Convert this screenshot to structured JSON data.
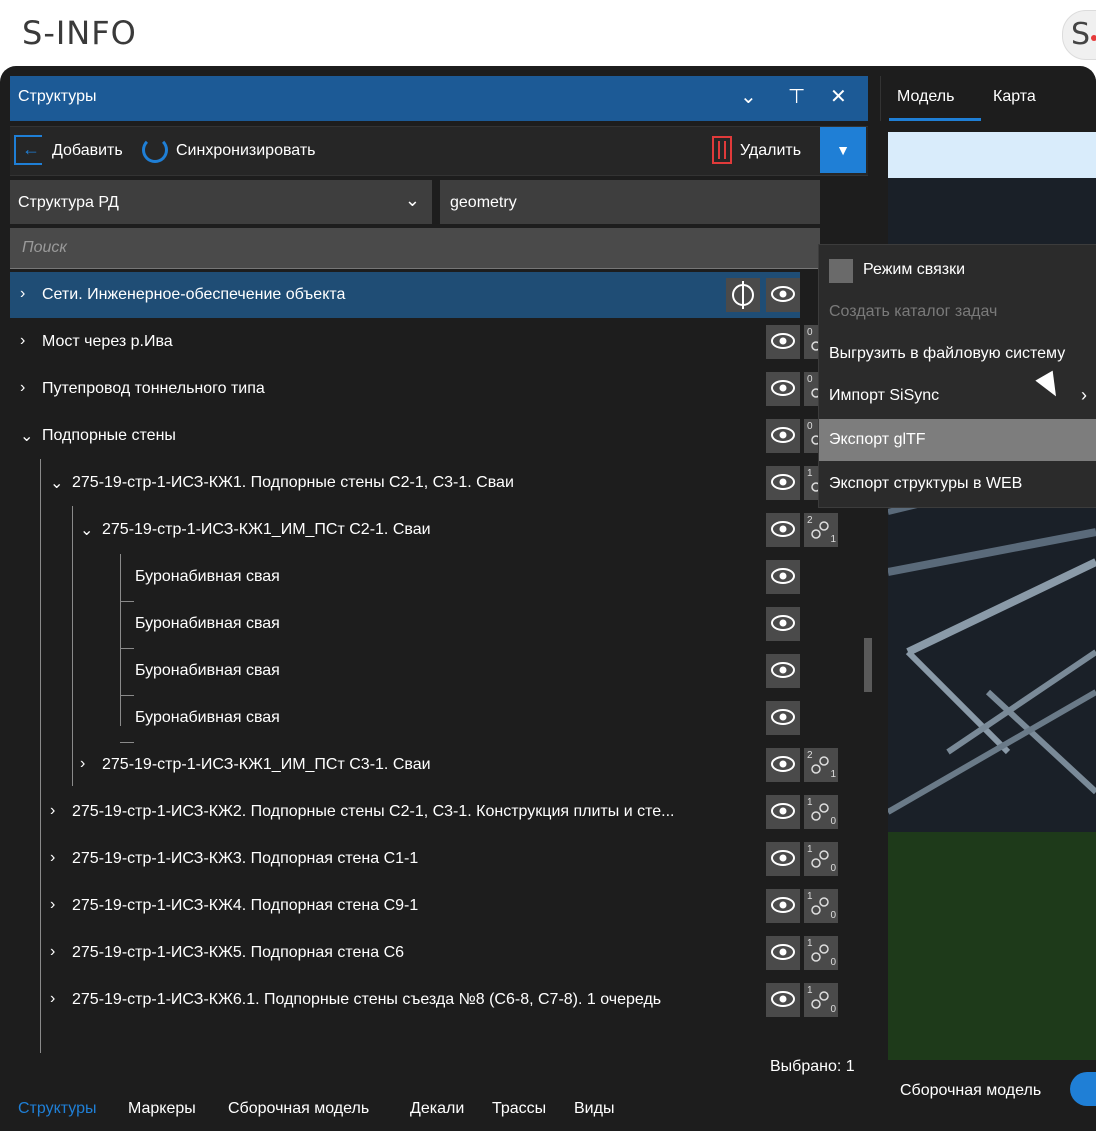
{
  "app": {
    "title": "S-INFO",
    "logo_letter": "S"
  },
  "panel": {
    "title": "Структуры",
    "header_icons": [
      "chevron-down-icon",
      "pin-icon",
      "close-icon"
    ]
  },
  "toolbar": {
    "add_label": "Добавить",
    "sync_label": "Синхронизировать",
    "delete_label": "Удалить",
    "dropdown_glyph": "▼"
  },
  "filters": {
    "structure": "Структура РД",
    "geometry": "geometry",
    "search_placeholder": "Поиск"
  },
  "tree": [
    {
      "label": "Сети. Инженерное-обеспечение объекта",
      "expanded": false,
      "selected": true,
      "link_top": "",
      "link_bottom": ""
    },
    {
      "label": "Мост через р.Ива",
      "expanded": false,
      "link_top": "0",
      "link_bottom": ""
    },
    {
      "label": "Путепровод тоннельного типа",
      "expanded": false,
      "link_top": "0",
      "link_bottom": ""
    },
    {
      "label": "Подпорные стены",
      "expanded": true,
      "link_top": "0",
      "link_bottom": "1"
    },
    {
      "label": "275-19-стр-1-ИСЗ-КЖ1. Подпорные стены С2-1, С3-1. Сваи",
      "expanded": true,
      "link_top": "1",
      "link_bottom": "0"
    },
    {
      "label": "275-19-стр-1-ИСЗ-КЖ1_ИМ_ПСт С2-1. Сваи",
      "expanded": true,
      "link_top": "2",
      "link_bottom": "1"
    },
    {
      "label": "Буронабивная свая"
    },
    {
      "label": "Буронабивная свая"
    },
    {
      "label": "Буронабивная свая"
    },
    {
      "label": "Буронабивная свая"
    },
    {
      "label": "275-19-стр-1-ИСЗ-КЖ1_ИМ_ПСт С3-1. Сваи",
      "expanded": false,
      "link_top": "2",
      "link_bottom": "1"
    },
    {
      "label": "275-19-стр-1-ИСЗ-КЖ2. Подпорные стены С2-1, С3-1. Конструкция плиты и сте...",
      "expanded": false,
      "link_top": "1",
      "link_bottom": "0"
    },
    {
      "label": "275-19-стр-1-ИСЗ-КЖ3. Подпорная стена С1-1",
      "expanded": false,
      "link_top": "1",
      "link_bottom": "0"
    },
    {
      "label": "275-19-стр-1-ИСЗ-КЖ4. Подпорная стена С9-1",
      "expanded": false,
      "link_top": "1",
      "link_bottom": "0"
    },
    {
      "label": "275-19-стр-1-ИСЗ-КЖ5. Подпорная стена С6",
      "expanded": false,
      "link_top": "1",
      "link_bottom": "0"
    },
    {
      "label": "275-19-стр-1-ИСЗ-КЖ6.1. Подпорные стены съезда №8 (С6-8, С7-8). 1 очередь",
      "expanded": false,
      "link_top": "1",
      "link_bottom": "0"
    }
  ],
  "status": {
    "selected": "Выбрано: 1"
  },
  "bottom_tabs": [
    "Структуры",
    "Маркеры",
    "Сборочная модель",
    "Декали",
    "Трассы",
    "Виды"
  ],
  "right_panel": {
    "tabs": [
      "Модель",
      "Карта"
    ],
    "assembly_label": "Сборочная модель"
  },
  "context_menu": {
    "items": [
      {
        "label": "Режим связки",
        "checkbox": true
      },
      {
        "label": "Создать каталог задач",
        "disabled": true
      },
      {
        "label": "Выгрузить в файловую систему"
      },
      {
        "label": "Импорт SiSync",
        "submenu": true
      },
      {
        "label": "Экспорт glTF",
        "hover": true
      },
      {
        "label": "Экспорт структуры в WEB"
      }
    ]
  },
  "colors": {
    "accent": "#1f7fd6",
    "header": "#1c5a96",
    "selected_row": "#1f4d75",
    "delete": "#e03a3a"
  }
}
